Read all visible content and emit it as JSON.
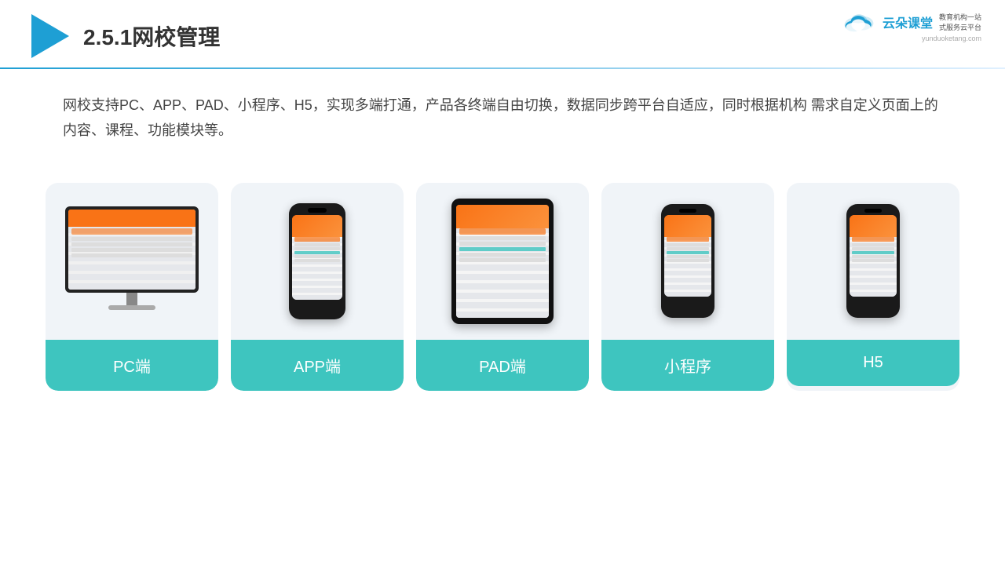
{
  "header": {
    "title": "2.5.1网校管理",
    "brand": {
      "name": "云朵课堂",
      "url": "yunduoketang.com",
      "tagline1": "教育机构一站",
      "tagline2": "式服务云平台"
    }
  },
  "description": "网校支持PC、APP、PAD、小程序、H5，实现多端打通，产品各终端自由切换，数据同步跨平台自适应，同时根据机构\n需求自定义页面上的内容、课程、功能模块等。",
  "cards": [
    {
      "id": "pc",
      "label": "PC端",
      "type": "pc"
    },
    {
      "id": "app",
      "label": "APP端",
      "type": "phone"
    },
    {
      "id": "pad",
      "label": "PAD端",
      "type": "tablet"
    },
    {
      "id": "miniapp",
      "label": "小程序",
      "type": "phone-small"
    },
    {
      "id": "h5",
      "label": "H5",
      "type": "phone-small"
    }
  ],
  "colors": {
    "accent": "#1e9fd4",
    "card_bg": "#eef2f7",
    "label_bg": "#3ec5bf",
    "text_dark": "#333333"
  }
}
